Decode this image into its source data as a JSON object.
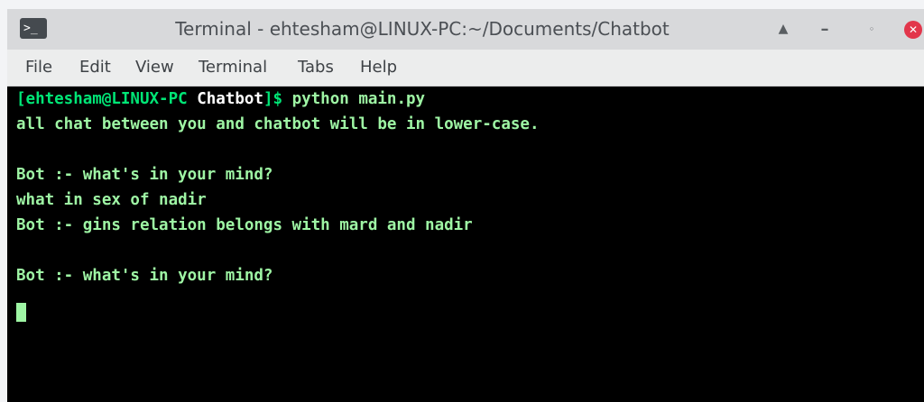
{
  "window": {
    "title": "Terminal - ehtesham@LINUX-PC:~/Documents/Chatbot",
    "app_icon": ">_",
    "controls": {
      "eject": "▲",
      "minimize": "–",
      "maximize": "◦",
      "close": "✕"
    }
  },
  "menu": {
    "items": [
      "File",
      "Edit",
      "View",
      "Terminal",
      "Tabs",
      "Help"
    ]
  },
  "terminal": {
    "prompt": {
      "open": "[ehtesham@LINUX-PC ",
      "dir": "Chatbot",
      "close": "]$ ",
      "command": "python main.py"
    },
    "lines": [
      "all chat between you and chatbot will be in lower-case.",
      "",
      "Bot :- what's in your mind?",
      "what in sex of nadir",
      "Bot :- gins relation belongs with mard and nadir",
      "",
      "Bot :- what's in your mind?"
    ]
  },
  "colors": {
    "terminal_bg": "#000000",
    "terminal_text": "#9ef5a4",
    "prompt": "#00e676",
    "close_button": "#e2364b"
  }
}
